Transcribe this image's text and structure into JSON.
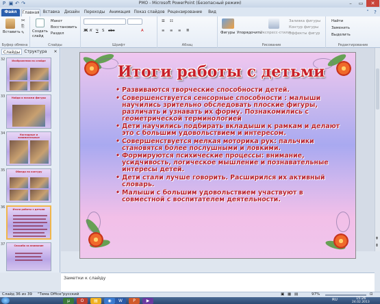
{
  "window": {
    "title": "РМО - Microsoft PowerPoint (Безопасный режим)",
    "minimize_icon": "minimize-icon",
    "maximize_icon": "maximize-icon",
    "close_icon": "close-icon"
  },
  "ribbon_tabs": [
    "Файл",
    "Главная",
    "Вставка",
    "Дизайн",
    "Переходы",
    "Анимация",
    "Показ слайдов",
    "Рецензирование",
    "Вид"
  ],
  "ribbon": {
    "clipboard": {
      "paste": "Вставить",
      "label": "Буфер обмена"
    },
    "slides": {
      "new_slide": "Создать слайд",
      "layout": "Макет",
      "reset": "Восстановить",
      "section": "Раздел",
      "label": "Слайды"
    },
    "font": {
      "label": "Шрифт"
    },
    "paragraph": {
      "label": "Абзац"
    },
    "drawing": {
      "shapes": "Фигуры",
      "arrange": "Упорядочить",
      "quick_styles": "Экспресс-стили",
      "fill": "Заливка фигуры",
      "outline": "Контур фигуры",
      "effects": "Эффекты фигур",
      "label": "Рисование"
    },
    "editing": {
      "find": "Найти",
      "replace": "Заменить",
      "select": "Выделить",
      "label": "Редактирование"
    }
  },
  "left_pane": {
    "tabs": [
      "Слайды",
      "Структура"
    ],
    "thumbs": [
      {
        "num": "32",
        "title": "Изображения на слайде"
      },
      {
        "num": "33",
        "title": "Найди и покажи фигуры"
      },
      {
        "num": "34",
        "title": "Наглядные и занимательные"
      },
      {
        "num": "35",
        "title": "Обведи по контуру"
      },
      {
        "num": "36",
        "title": "Итоги работы с детьми"
      },
      {
        "num": "37",
        "title": "Спасибо за внимание"
      }
    ]
  },
  "slide": {
    "title": "Итоги работы с детьми",
    "bullets": [
      "Развиваются творческие способности детей.",
      "Совершенствуется сенсорные способности : малыши научились зрительно обследовать плоские фигуры, различать и узнавать их форму. Познакомились с геометрической терминологией",
      "Дети научились подбирать вкладыши к рамкам и делают это с большим удовольствием и интересом.",
      "Совершенствуется мелкая моторика рук: пальчики становятся более послушными и ловкими.",
      "Формируются психические процессы: внимание, усидчивость, логическое мышление и познавательные интересы детей.",
      "Дети стали лучше говорить. Расширился их активный словарь.",
      "Малыши с большим удовольствием участвуют в совместной с воспитателем деятельности."
    ]
  },
  "notes_placeholder": "Заметки к слайду",
  "status": {
    "slide_info": "Слайд 36 из 39",
    "theme": "\"Тема Office\"",
    "language": "русский",
    "zoom": "97%"
  },
  "taskbar": {
    "start_icon": "windows-start-icon",
    "time": "15:26",
    "date": "24.02.2013",
    "lang": "RU"
  }
}
